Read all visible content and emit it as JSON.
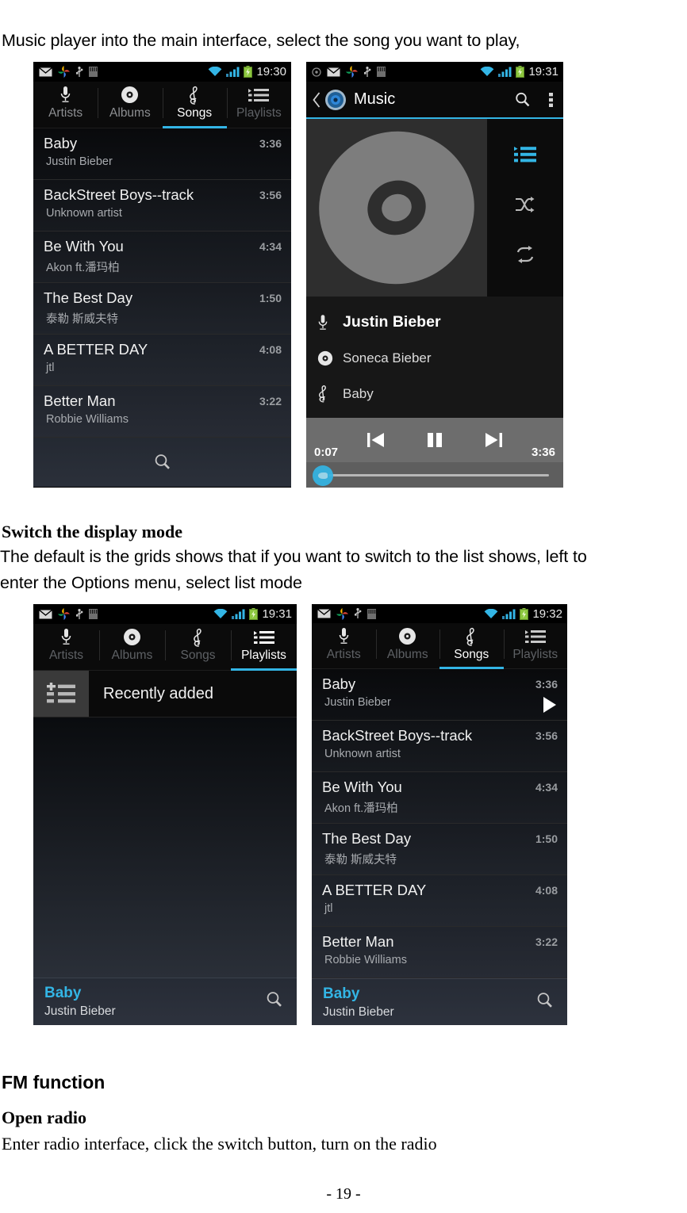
{
  "document": {
    "intro": "Music player into the main interface, select the song you want to play,",
    "switch_heading": "Switch the display mode",
    "switch_body_line1": "The default is the grids shows that if you want to switch to the list shows, left to",
    "switch_body_line2": "enter the Options menu, select list mode",
    "fm_heading": "FM function",
    "open_radio_heading": "Open radio",
    "open_radio_body": "Enter radio interface, click the switch button, turn on the radio",
    "page_number": "- 19 -"
  },
  "colors": {
    "accent_blue": "#33b5e5",
    "status_green": "#8cc63f",
    "screen_black": "#0a0a0a",
    "controls_grey": "#6d6d6d"
  },
  "tabs": {
    "artists": "Artists",
    "albums": "Albums",
    "songs": "Songs",
    "playlists": "Playlists"
  },
  "songs": [
    {
      "title": "Baby",
      "artist": "Justin Bieber",
      "duration": "3:36"
    },
    {
      "title": "BackStreet Boys--track",
      "artist": "Unknown artist",
      "duration": "3:56"
    },
    {
      "title": "Be With You",
      "artist": "Akon ft.潘玛柏",
      "duration": "4:34"
    },
    {
      "title": "The Best Day",
      "artist": "泰勒 斯威夫特",
      "duration": "1:50"
    },
    {
      "title": "A BETTER DAY",
      "artist": "jtl",
      "duration": "4:08"
    },
    {
      "title": "Better Man",
      "artist": "Robbie Williams",
      "duration": "3:22"
    }
  ],
  "shot1": {
    "status_time": "19:30",
    "active_tab": "Songs"
  },
  "shot2": {
    "status_time": "19:31",
    "actionbar_title": "Music",
    "artist": "Justin Bieber",
    "album": "Soneca Bieber",
    "track": "Baby",
    "elapsed": "0:07",
    "total": "3:36"
  },
  "shot3": {
    "status_time": "19:31",
    "active_tab": "Playlists",
    "playlist_name": "Recently added",
    "nowplaying_title": "Baby",
    "nowplaying_artist": "Justin Bieber"
  },
  "shot4": {
    "status_time": "19:32",
    "active_tab": "Songs",
    "nowplaying_title": "Baby",
    "nowplaying_artist": "Justin Bieber"
  }
}
